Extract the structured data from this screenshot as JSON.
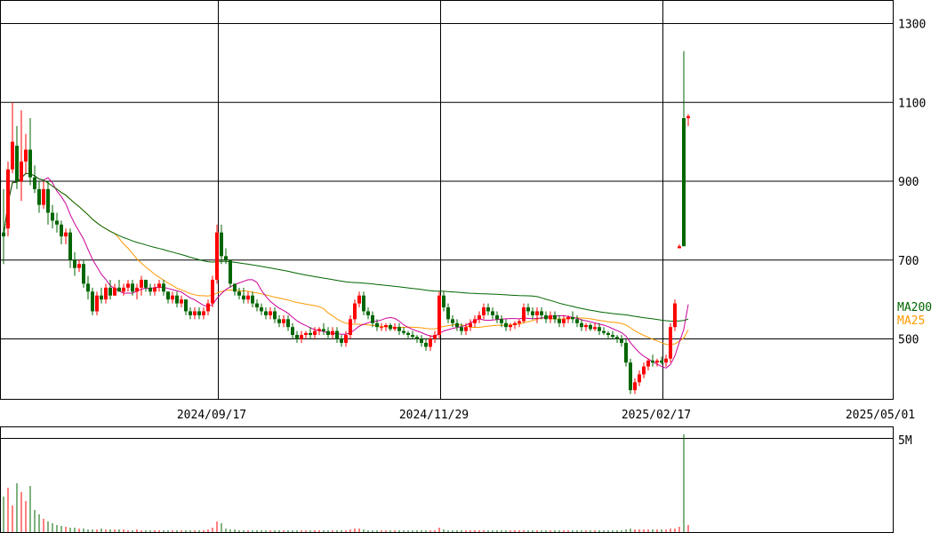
{
  "chart_data": [
    {
      "type": "candlestick",
      "y_ticks": [
        "1300",
        "1100",
        "900",
        "700",
        "500"
      ],
      "y_tick_values": [
        1300,
        1100,
        900,
        700,
        500
      ],
      "ylim": [
        350,
        1350
      ],
      "x_ticks": [
        "2024/09/17",
        "2024/11/29",
        "2025/02/17",
        "2025/05/01"
      ],
      "x_tick_index": [
        48,
        98,
        148,
        198
      ],
      "grid": true,
      "colors": {
        "up": "#ff0000",
        "down": "#006600",
        "ma25": "#ff9900",
        "ma75": "#cc0099",
        "ma200": "#006600"
      },
      "legend": [
        {
          "label": "MA200",
          "color": "#006600"
        },
        {
          "label": "MA25",
          "color": "#ff9900"
        }
      ],
      "candles": [
        [
          770,
          880,
          690,
          760
        ],
        [
          780,
          950,
          760,
          930
        ],
        [
          930,
          1100,
          920,
          1000
        ],
        [
          990,
          1040,
          880,
          900
        ],
        [
          900,
          1080,
          850,
          950
        ],
        [
          950,
          1020,
          920,
          980
        ],
        [
          980,
          1060,
          890,
          910
        ],
        [
          910,
          940,
          870,
          880
        ],
        [
          880,
          900,
          820,
          840
        ],
        [
          840,
          900,
          830,
          880
        ],
        [
          880,
          900,
          790,
          820
        ],
        [
          820,
          840,
          780,
          800
        ],
        [
          800,
          820,
          770,
          790
        ],
        [
          790,
          800,
          740,
          760
        ],
        [
          760,
          780,
          740,
          770
        ],
        [
          770,
          780,
          680,
          700
        ],
        [
          700,
          720,
          660,
          680
        ],
        [
          680,
          700,
          670,
          690
        ],
        [
          690,
          700,
          630,
          640
        ],
        [
          640,
          660,
          600,
          620
        ],
        [
          620,
          630,
          560,
          570
        ],
        [
          570,
          620,
          560,
          610
        ],
        [
          610,
          630,
          590,
          600
        ],
        [
          600,
          640,
          590,
          630
        ],
        [
          630,
          650,
          600,
          610
        ],
        [
          610,
          640,
          610,
          630
        ],
        [
          630,
          650,
          620,
          620
        ],
        [
          620,
          640,
          610,
          630
        ],
        [
          630,
          650,
          620,
          640
        ],
        [
          640,
          650,
          610,
          620
        ],
        [
          620,
          640,
          600,
          630
        ],
        [
          630,
          660,
          610,
          650
        ],
        [
          650,
          650,
          620,
          630
        ],
        [
          630,
          640,
          610,
          620
        ],
        [
          620,
          640,
          610,
          630
        ],
        [
          630,
          650,
          620,
          640
        ],
        [
          640,
          650,
          610,
          620
        ],
        [
          620,
          620,
          590,
          600
        ],
        [
          600,
          620,
          590,
          610
        ],
        [
          610,
          620,
          580,
          590
        ],
        [
          590,
          610,
          580,
          600
        ],
        [
          600,
          600,
          560,
          570
        ],
        [
          570,
          580,
          550,
          560
        ],
        [
          560,
          580,
          550,
          570
        ],
        [
          570,
          580,
          550,
          560
        ],
        [
          560,
          580,
          550,
          570
        ],
        [
          570,
          600,
          560,
          590
        ],
        [
          590,
          660,
          580,
          650
        ],
        [
          650,
          790,
          640,
          770
        ],
        [
          770,
          790,
          690,
          710
        ],
        [
          710,
          730,
          690,
          700
        ],
        [
          700,
          650,
          630,
          640
        ],
        [
          640,
          640,
          610,
          620
        ],
        [
          620,
          630,
          600,
          610
        ],
        [
          610,
          630,
          590,
          600
        ],
        [
          600,
          620,
          590,
          610
        ],
        [
          610,
          620,
          580,
          590
        ],
        [
          590,
          600,
          570,
          580
        ],
        [
          580,
          590,
          560,
          570
        ],
        [
          570,
          580,
          550,
          560
        ],
        [
          560,
          580,
          550,
          570
        ],
        [
          570,
          580,
          540,
          550
        ],
        [
          550,
          560,
          530,
          540
        ],
        [
          540,
          560,
          530,
          550
        ],
        [
          550,
          560,
          520,
          530
        ],
        [
          530,
          540,
          500,
          510
        ],
        [
          510,
          520,
          490,
          500
        ],
        [
          500,
          520,
          490,
          510
        ],
        [
          510,
          520,
          500,
          515
        ],
        [
          515,
          530,
          500,
          510
        ],
        [
          510,
          530,
          500,
          520
        ],
        [
          520,
          530,
          510,
          525
        ],
        [
          525,
          540,
          510,
          520
        ],
        [
          520,
          530,
          500,
          510
        ],
        [
          510,
          530,
          500,
          520
        ],
        [
          520,
          530,
          490,
          500
        ],
        [
          500,
          510,
          480,
          490
        ],
        [
          490,
          520,
          480,
          510
        ],
        [
          510,
          560,
          500,
          550
        ],
        [
          550,
          600,
          540,
          590
        ],
        [
          590,
          620,
          580,
          610
        ],
        [
          610,
          620,
          560,
          570
        ],
        [
          570,
          580,
          550,
          560
        ],
        [
          560,
          570,
          530,
          540
        ],
        [
          540,
          550,
          520,
          530
        ],
        [
          530,
          540,
          520,
          530
        ],
        [
          530,
          540,
          520,
          535
        ],
        [
          535,
          540,
          520,
          525
        ],
        [
          525,
          540,
          520,
          530
        ],
        [
          530,
          540,
          510,
          520
        ],
        [
          520,
          530,
          510,
          515
        ],
        [
          515,
          520,
          500,
          510
        ],
        [
          510,
          520,
          500,
          505
        ],
        [
          505,
          510,
          490,
          500
        ],
        [
          500,
          510,
          480,
          490
        ],
        [
          490,
          500,
          470,
          480
        ],
        [
          480,
          510,
          470,
          500
        ],
        [
          500,
          520,
          490,
          510
        ],
        [
          510,
          620,
          500,
          610
        ],
        [
          610,
          620,
          570,
          580
        ],
        [
          580,
          590,
          540,
          550
        ],
        [
          550,
          560,
          530,
          540
        ],
        [
          540,
          550,
          520,
          530
        ],
        [
          530,
          540,
          510,
          520
        ],
        [
          520,
          540,
          510,
          530
        ],
        [
          530,
          550,
          520,
          540
        ],
        [
          540,
          560,
          530,
          550
        ],
        [
          550,
          570,
          540,
          560
        ],
        [
          560,
          590,
          550,
          580
        ],
        [
          580,
          590,
          560,
          570
        ],
        [
          570,
          580,
          550,
          560
        ],
        [
          560,
          570,
          540,
          550
        ],
        [
          550,
          560,
          530,
          540
        ],
        [
          540,
          550,
          520,
          530
        ],
        [
          530,
          540,
          520,
          535
        ],
        [
          535,
          545,
          525,
          540
        ],
        [
          540,
          550,
          530,
          545
        ],
        [
          545,
          590,
          540,
          580
        ],
        [
          580,
          590,
          560,
          570
        ],
        [
          570,
          580,
          550,
          560
        ],
        [
          560,
          580,
          540,
          570
        ],
        [
          570,
          580,
          550,
          560
        ],
        [
          560,
          570,
          540,
          550
        ],
        [
          550,
          570,
          540,
          560
        ],
        [
          560,
          570,
          540,
          550
        ],
        [
          550,
          560,
          530,
          540
        ],
        [
          540,
          560,
          530,
          550
        ],
        [
          550,
          560,
          540,
          555
        ],
        [
          555,
          570,
          540,
          550
        ],
        [
          550,
          560,
          530,
          540
        ],
        [
          540,
          550,
          520,
          530
        ],
        [
          530,
          540,
          520,
          535
        ],
        [
          535,
          540,
          520,
          525
        ],
        [
          525,
          540,
          520,
          530
        ],
        [
          530,
          540,
          510,
          520
        ],
        [
          520,
          530,
          510,
          515
        ],
        [
          515,
          520,
          500,
          510
        ],
        [
          510,
          520,
          500,
          505
        ],
        [
          505,
          510,
          490,
          500
        ],
        [
          500,
          510,
          480,
          490
        ],
        [
          490,
          500,
          430,
          440
        ],
        [
          440,
          450,
          360,
          370
        ],
        [
          370,
          400,
          360,
          390
        ],
        [
          390,
          420,
          380,
          410
        ],
        [
          410,
          440,
          400,
          430
        ],
        [
          430,
          450,
          420,
          445
        ],
        [
          445,
          460,
          430,
          440
        ],
        [
          440,
          450,
          430,
          445
        ],
        [
          445,
          455,
          435,
          440
        ],
        [
          440,
          460,
          430,
          450
        ],
        [
          450,
          540,
          440,
          530
        ],
        [
          530,
          600,
          520,
          590
        ],
        [
          730,
          740,
          730,
          735
        ],
        [
          1060,
          1230,
          740,
          735
        ],
        [
          1060,
          1070,
          1040,
          1065
        ]
      ],
      "volume_label": "5M"
    }
  ]
}
